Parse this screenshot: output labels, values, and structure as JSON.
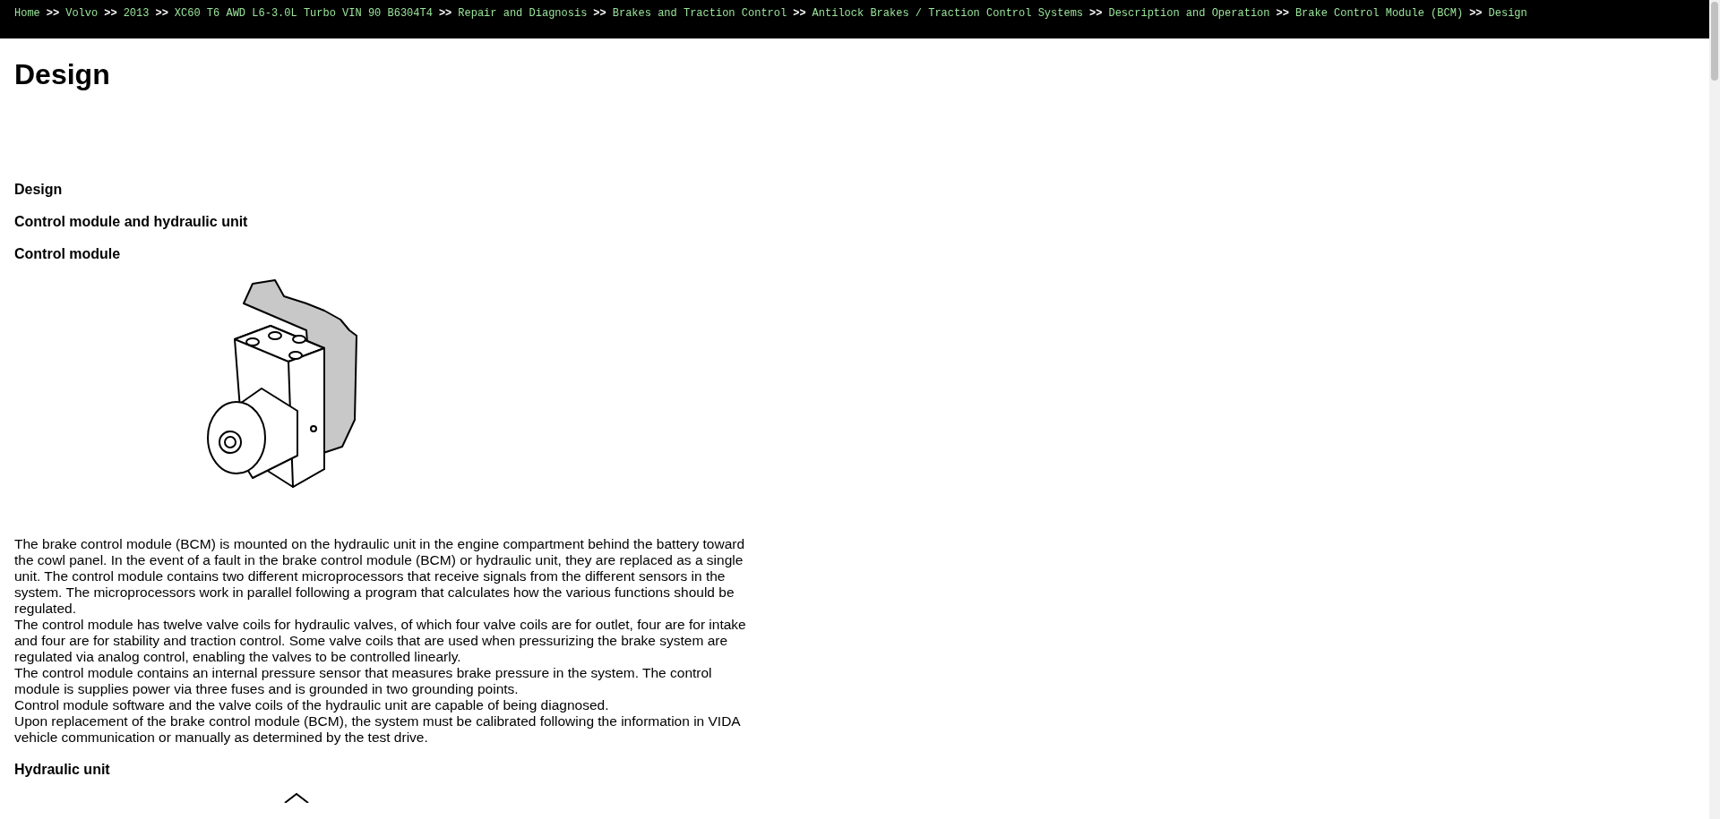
{
  "breadcrumb": [
    {
      "label": "Home"
    },
    {
      "label": "Volvo"
    },
    {
      "label": "2013"
    },
    {
      "label": "XC60 T6 AWD L6-3.0L Turbo VIN 90 B6304T4"
    },
    {
      "label": "Repair and Diagnosis"
    },
    {
      "label": "Brakes and Traction Control"
    },
    {
      "label": "Antilock Brakes / Traction Control Systems"
    },
    {
      "label": "Description and Operation"
    },
    {
      "label": "Brake Control Module (BCM)"
    },
    {
      "label": "Design"
    }
  ],
  "separator": ">>",
  "title": "Design",
  "headings": [
    "Design",
    "Control module and hydraulic unit",
    "Control module"
  ],
  "paragraphs": [
    "The brake control module (BCM) is mounted on the hydraulic unit in the engine compartment behind the battery toward the cowl panel. In the event of a fault in the brake control module (BCM) or hydraulic unit, they are replaced as a single unit. The control module contains two different microprocessors that receive signals from the different sensors in the system. The microprocessors work in parallel following a program that calculates how the various functions should be regulated.",
    "The control module has twelve valve coils for hydraulic valves, of which four valve coils are for outlet, four are for intake and four are for stability and traction control. Some valve coils that are used when pressurizing the brake system are regulated via analog control, enabling the valves to be controlled linearly.",
    "The control module contains an internal pressure sensor that measures brake pressure in the system. The control module is supplies power via three fuses and is grounded in two grounding points.",
    "Control module software and the valve coils of the hydraulic unit are capable of being diagnosed.",
    "Upon replacement of the brake control module (BCM), the system must be calibrated following the information in VIDA vehicle communication or manually as determined by the test drive."
  ],
  "subheading": "Hydraulic unit"
}
